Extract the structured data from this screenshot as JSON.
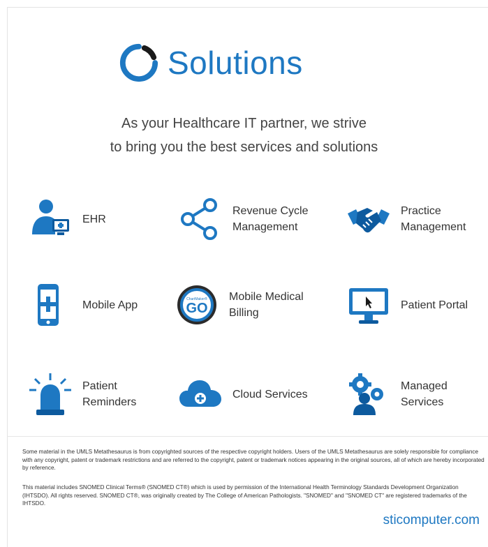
{
  "header": {
    "title": "Solutions"
  },
  "tagline": {
    "line1": "As your Healthcare IT partner, we strive",
    "line2": "to bring you the best services and solutions"
  },
  "colors": {
    "primary_blue": "#1e78c2",
    "dark_blue": "#0d5a9e",
    "text": "#333333"
  },
  "services": [
    {
      "icon": "ehr-user-computer-icon",
      "lines": [
        "EHR"
      ]
    },
    {
      "icon": "share-network-icon",
      "lines": [
        "Revenue Cycle",
        "Management"
      ]
    },
    {
      "icon": "handshake-icon",
      "lines": [
        "Practice",
        "Management"
      ]
    },
    {
      "icon": "mobile-phone-medical-icon",
      "lines": [
        "Mobile App"
      ]
    },
    {
      "icon": "chartmaker-go-logo-icon",
      "lines": [
        "Mobile Medical",
        "Billing"
      ],
      "logo_text": {
        "small": "ChartMaker®",
        "big": "GO"
      }
    },
    {
      "icon": "monitor-cursor-icon",
      "lines": [
        "Patient Portal"
      ]
    },
    {
      "icon": "siren-alarm-icon",
      "lines": [
        "Patient",
        "Reminders"
      ]
    },
    {
      "icon": "cloud-upload-icon",
      "lines": [
        "Cloud Services"
      ]
    },
    {
      "icon": "gears-user-icon",
      "lines": [
        "Managed",
        "Services"
      ]
    }
  ],
  "footer": {
    "disclaimer1": "Some material in the UMLS Metathesaurus is from copyrighted sources of the respective copyright holders. Users of the UMLS Metathesaurus are solely responsible for compliance with any copyright, patent or trademark restrictions and are referred to the copyright, patent or trademark notices appearing in the original sources, all of which are hereby incorporated by reference.",
    "disclaimer2": "This material includes SNOMED Clinical Terms® (SNOMED CT®) which is used by permission of the International Health Terminology Standards Development Organization (IHTSDO). All rights reserved. SNOMED CT®, was originally created by The College of American Pathologists. \"SNOMED\" and \"SNOMED CT\" are registered trademarks of the IHTSDO.",
    "website": "sticomputer.com"
  }
}
